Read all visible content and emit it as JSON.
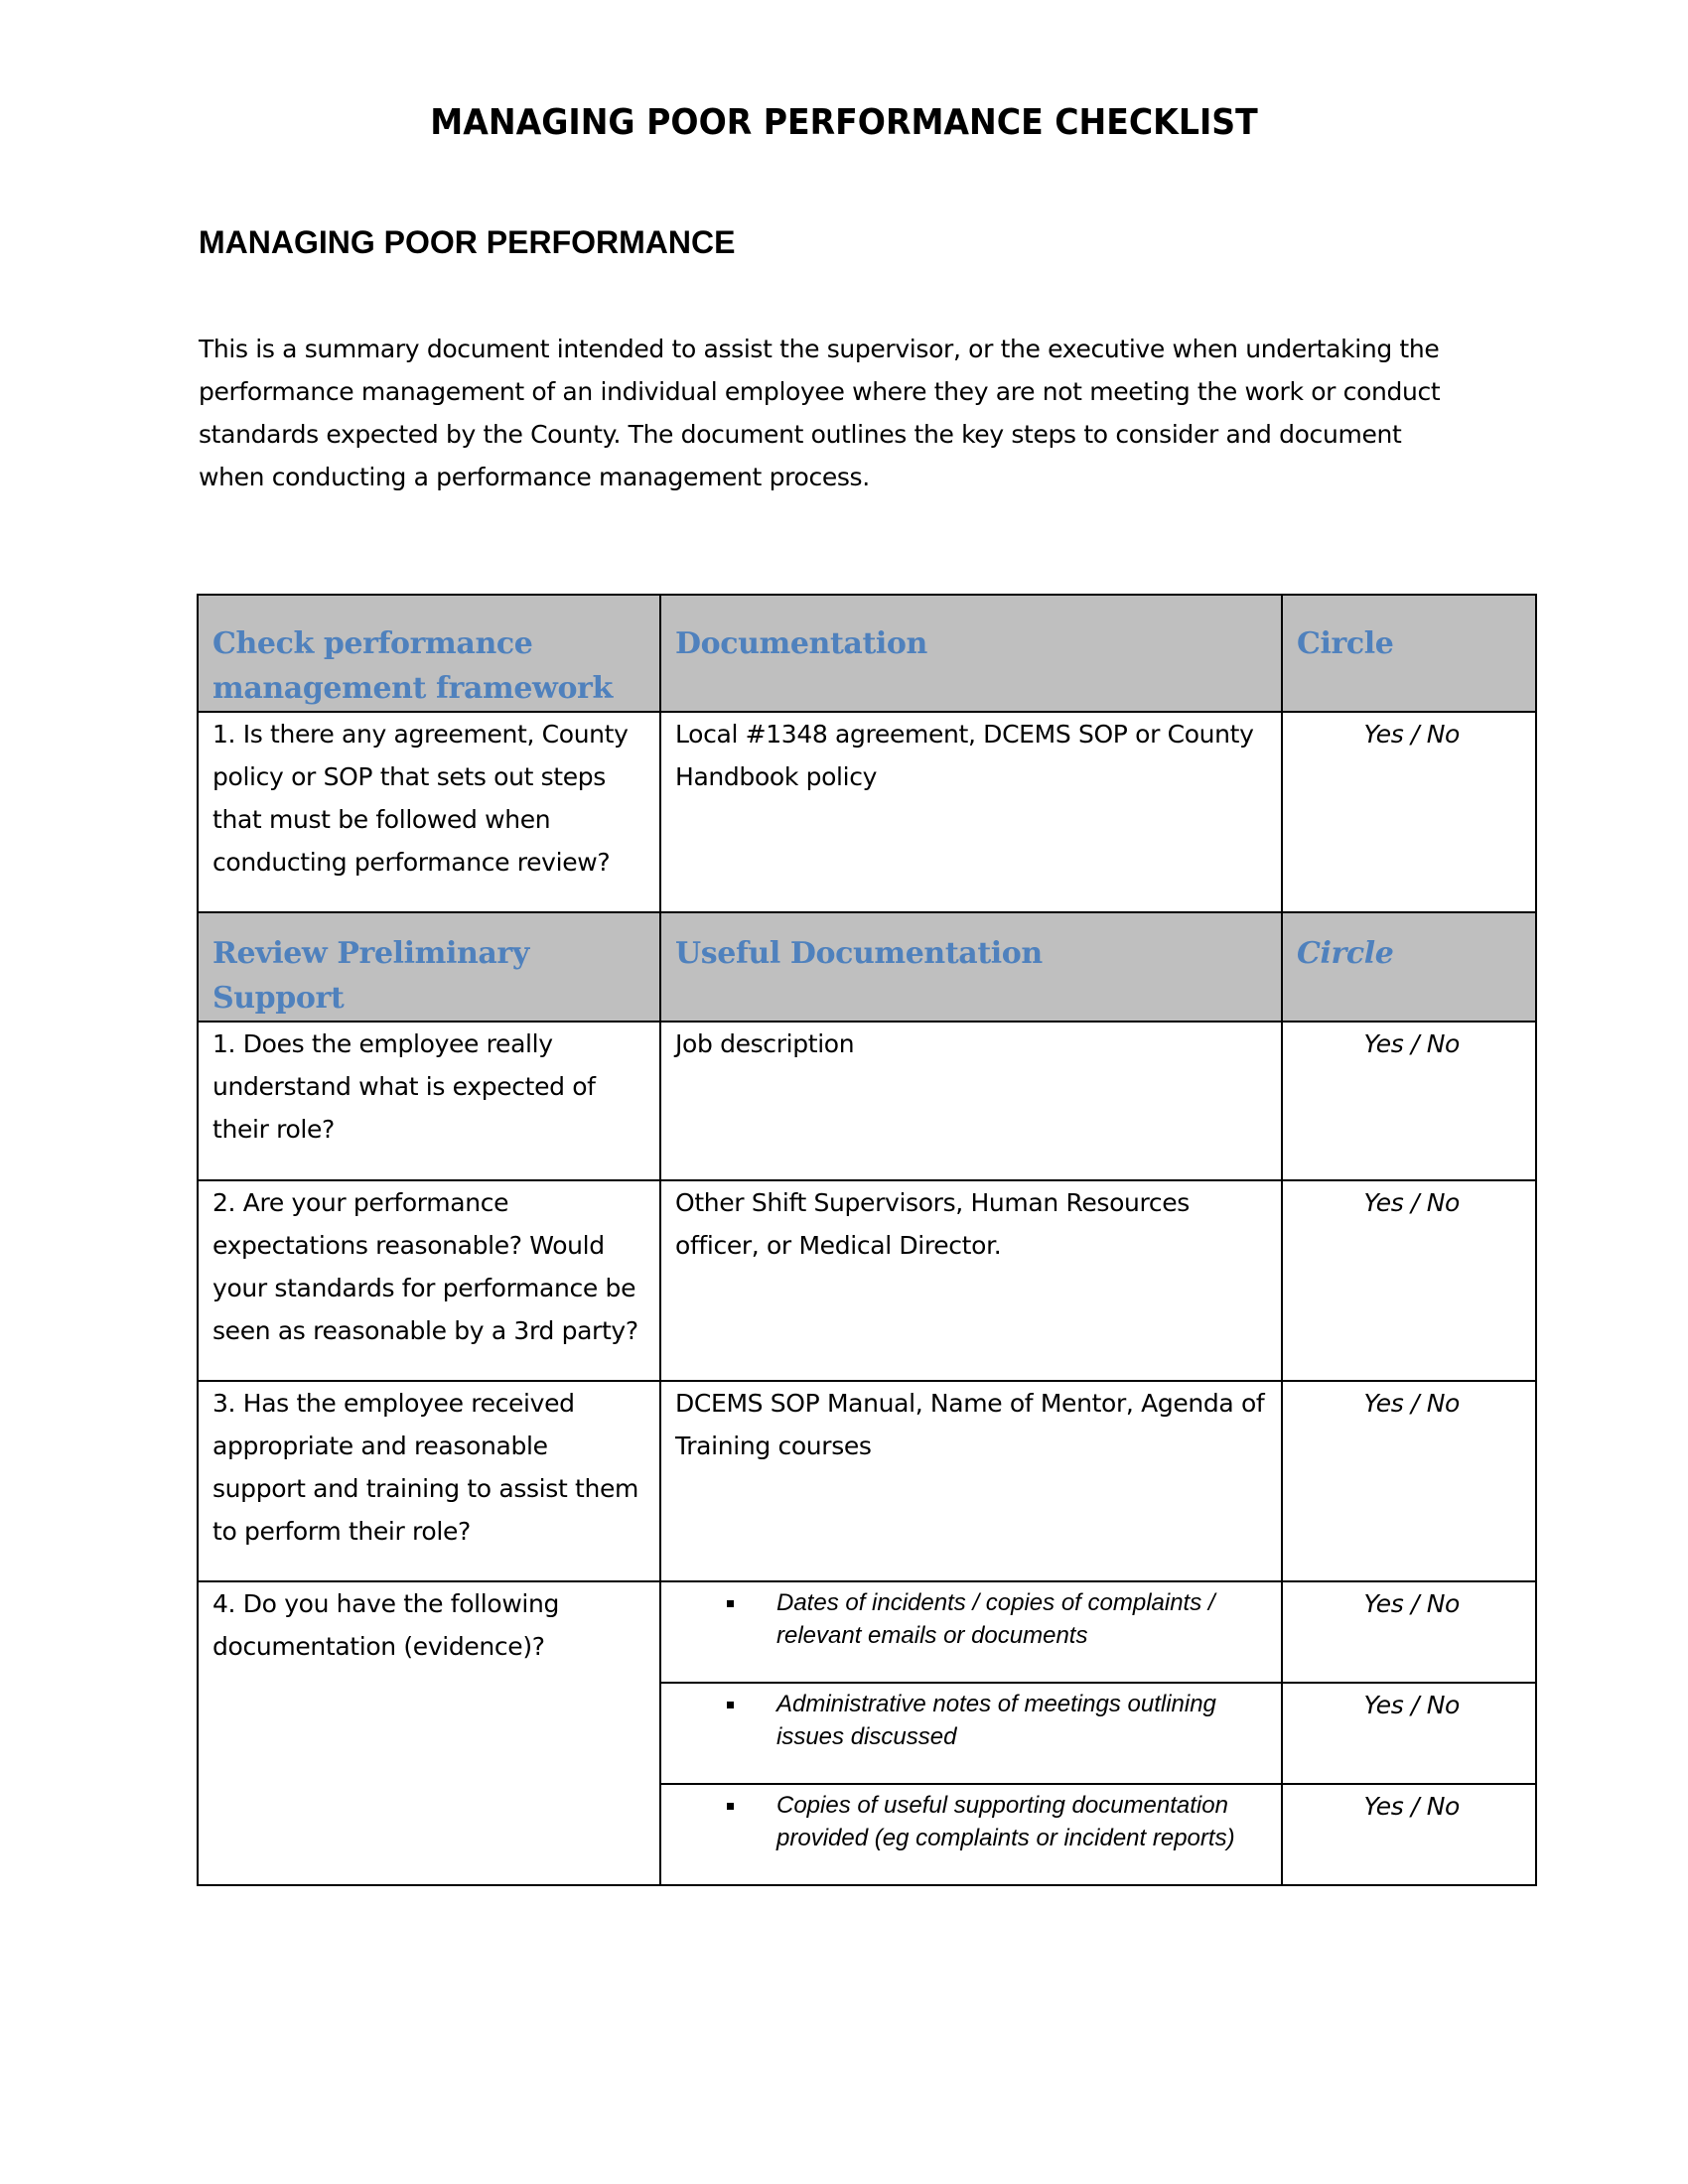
{
  "document": {
    "title": "MANAGING POOR PERFORMANCE CHECKLIST",
    "section_heading": "MANAGING POOR PERFORMANCE",
    "intro_lines": [
      "This is a summary document intended to assist the supervisor, or the executive when undertaking the",
      "performance management of an individual employee where they are not meeting the work or conduct",
      "standards expected by the County. The document outlines the key steps to consider and document",
      "when conducting a performance management process."
    ]
  },
  "table": {
    "framework_header": {
      "col1": "Check performance management framework",
      "col2": "Documentation",
      "col3": "Circle"
    },
    "framework_rows": [
      {
        "question": "1. Is there any agreement, County policy or SOP that sets out steps that must be followed when conducting performance review?",
        "documentation": "Local #1348 agreement, DCEMS SOP or County Handbook policy",
        "circle": "Yes / No"
      }
    ],
    "support_header": {
      "col1": "Review Preliminary Support",
      "col2": "Useful Documentation",
      "col3": "Circle"
    },
    "support_rows": [
      {
        "question": "1. Does the employee really understand what is expected of their role?",
        "documentation": "Job description",
        "circle": "Yes / No"
      },
      {
        "question": "2. Are your performance expectations reasonable? Would your standards for performance be seen as reasonable by a 3rd party?",
        "documentation": "Other Shift Supervisors, Human Resources officer, or Medical Director.",
        "circle": "Yes / No"
      },
      {
        "question": "3. Has the employee received appropriate and reasonable support and training to assist them to perform their role?",
        "documentation": "DCEMS SOP Manual, Name of Mentor, Agenda of Training courses",
        "circle": "Yes / No"
      }
    ],
    "evidence_row": {
      "question": "4. Do you have the following documentation (evidence)?",
      "items": [
        {
          "text": "Dates of incidents / copies of complaints / relevant emails or documents",
          "circle": "Yes / No"
        },
        {
          "text": "Administrative notes of meetings outlining issues discussed",
          "circle": "Yes / No"
        },
        {
          "text": "Copies of useful supporting documentation provided (eg complaints or incident reports)",
          "circle": "Yes / No"
        }
      ]
    }
  }
}
